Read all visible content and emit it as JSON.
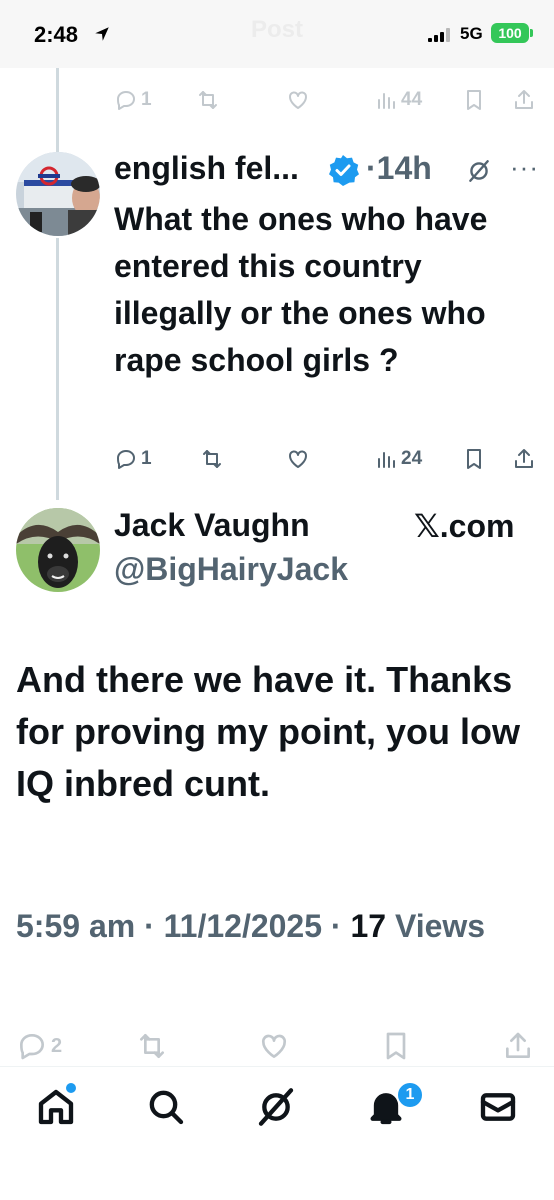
{
  "status_bar": {
    "time": "2:48",
    "ghost_title": "Post",
    "network": "5G",
    "battery": "100"
  },
  "top_actions": {
    "replies": "1",
    "views": "44"
  },
  "reply_tweet": {
    "display_name": "english fel...",
    "separator_time": "·14h",
    "more": "···",
    "text": "What the ones who have entered this country illegally or the ones who rape school girls ?",
    "replies": "1",
    "views": "24"
  },
  "main_tweet": {
    "display_name": "Jack Vaughn",
    "handle": "@BigHairyJack",
    "brand": "𝕏.com",
    "text": "And there we have it. Thanks for proving my point, you low IQ inbred cunt.",
    "time": "5:59 am",
    "date": "11/12/2025",
    "views_count": "17",
    "views_label": "Views",
    "dot": " · "
  },
  "bottom_actions": {
    "replies": "2"
  },
  "nav": {
    "notifications_badge": "1"
  },
  "colors": {
    "accent": "#1d9bf0",
    "secondary_text": "#536471",
    "primary_text": "#0f1419",
    "battery": "#34c759"
  }
}
